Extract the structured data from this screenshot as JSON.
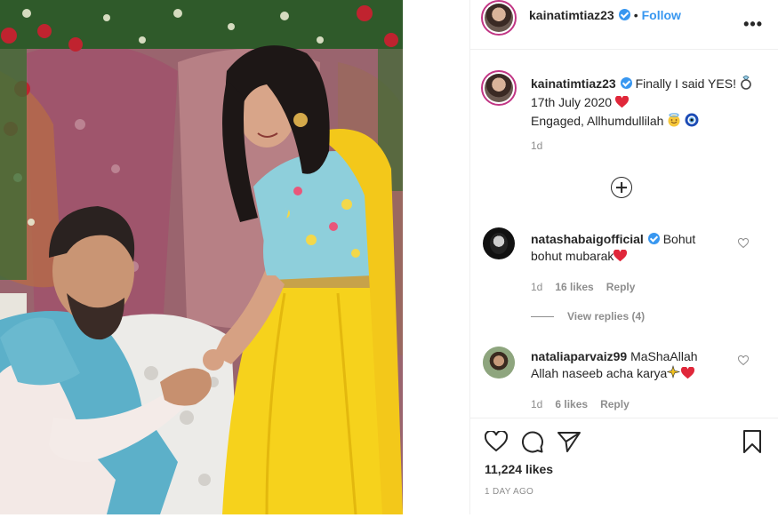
{
  "post": {
    "username": "kainatimtiaz23",
    "follow_label": "Follow",
    "more_label": "•••",
    "dot": "•"
  },
  "caption": {
    "username": "kainatimtiaz23",
    "line1": "Finally I said YES!",
    "line2": "17th July 2020",
    "line3": "Engaged, Allhumdullilah",
    "age": "1d"
  },
  "comments": [
    {
      "username": "natashabaigofficial",
      "verified": true,
      "text_line1": "Bohut",
      "text_line2": "bohut mubarak",
      "age": "1d",
      "likes": "16 likes",
      "reply_label": "Reply",
      "view_replies": "View replies (4)"
    },
    {
      "username": "nataliaparvaiz99",
      "verified": false,
      "text_line1": "MaShaAllah",
      "text_line2": "Allah naseeb acha karya",
      "age": "1d",
      "likes": "6 likes",
      "reply_label": "Reply"
    }
  ],
  "actions": {
    "likes": "11,224 likes",
    "time": "1 DAY AGO"
  },
  "icons": {
    "verified": "verified-badge-icon",
    "ring": "ring-emoji-icon",
    "heart_red": "red-heart-emoji-icon",
    "smile": "smiling-halo-emoji-icon",
    "nazar": "nazar-amulet-emoji-icon",
    "sparkle": "sparkles-emoji-icon",
    "like": "heart-outline-icon",
    "comment": "comment-bubble-icon",
    "share": "paper-plane-icon",
    "save": "bookmark-icon",
    "add_comment": "plus-circle-icon"
  },
  "colors": {
    "link": "#3897f0",
    "text": "#262626",
    "secondary": "#8e8e8e",
    "heart": "#ed4956"
  }
}
